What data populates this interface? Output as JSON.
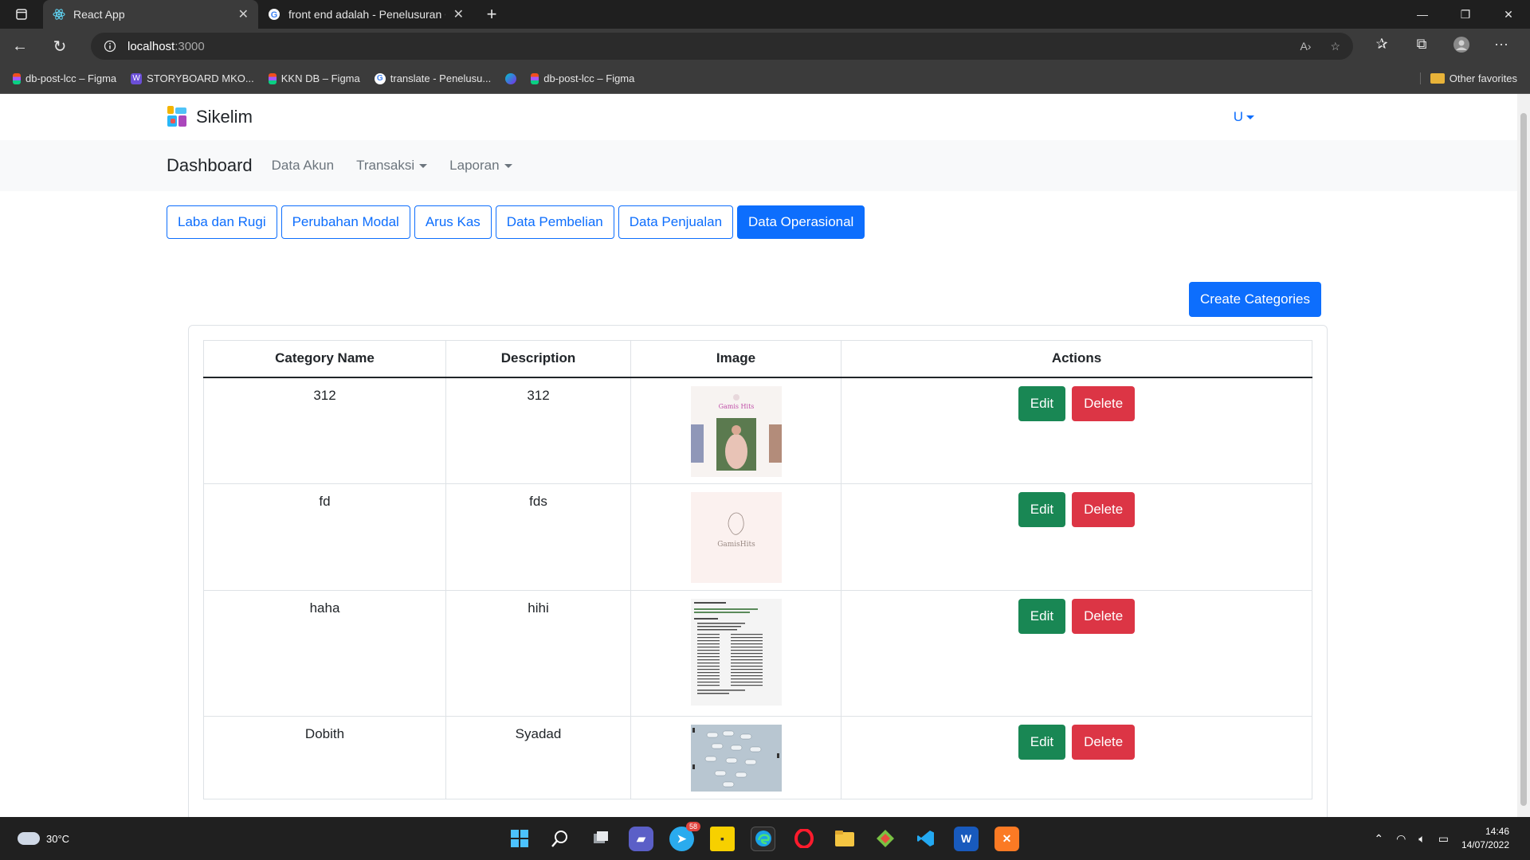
{
  "browser": {
    "tabs": [
      {
        "title": "React App",
        "active": true,
        "icon": "react-icon"
      },
      {
        "title": "front end adalah - Penelusuran G",
        "active": false,
        "icon": "google-icon"
      }
    ],
    "url_host": "localhost",
    "url_port": ":3000",
    "bookmarks": [
      {
        "label": "db-post-lcc – Figma",
        "icon": "figma-icon"
      },
      {
        "label": "STORYBOARD MKO...",
        "icon": "w-icon"
      },
      {
        "label": "KKN DB – Figma",
        "icon": "figma-icon"
      },
      {
        "label": "translate - Penelusu...",
        "icon": "google-icon"
      },
      {
        "label": "",
        "icon": "canva-icon"
      },
      {
        "label": "db-post-lcc – Figma",
        "icon": "figma-icon"
      }
    ],
    "other_favorites": "Other favorites"
  },
  "app": {
    "brand": "Sikelim",
    "user_menu": "U",
    "nav": {
      "dashboard": "Dashboard",
      "data_akun": "Data Akun",
      "transaksi": "Transaksi",
      "laporan": "Laporan"
    },
    "report_tabs": [
      {
        "label": "Laba dan Rugi",
        "active": false
      },
      {
        "label": "Perubahan Modal",
        "active": false
      },
      {
        "label": "Arus Kas",
        "active": false
      },
      {
        "label": "Data Pembelian",
        "active": false
      },
      {
        "label": "Data Penjualan",
        "active": false
      },
      {
        "label": "Data Operasional",
        "active": true
      }
    ],
    "create_button": "Create Categories",
    "table": {
      "headers": [
        "Category Name",
        "Description",
        "Image",
        "Actions"
      ],
      "rows": [
        {
          "name": "312",
          "description": "312",
          "image": "gamis-hits-photo"
        },
        {
          "name": "fd",
          "description": "fds",
          "image": "gamis-hits-logo"
        },
        {
          "name": "haha",
          "description": "hihi",
          "image": "code-screenshot"
        },
        {
          "name": "Dobith",
          "description": "Syadad",
          "image": "diagram-screenshot"
        }
      ],
      "edit_label": "Edit",
      "delete_label": "Delete"
    }
  },
  "taskbar": {
    "weather": "30°C",
    "time": "14:46",
    "date": "14/07/2022",
    "telegram_badge": "58"
  },
  "colors": {
    "primary": "#0d6efd",
    "success": "#198754",
    "danger": "#dc3545"
  }
}
